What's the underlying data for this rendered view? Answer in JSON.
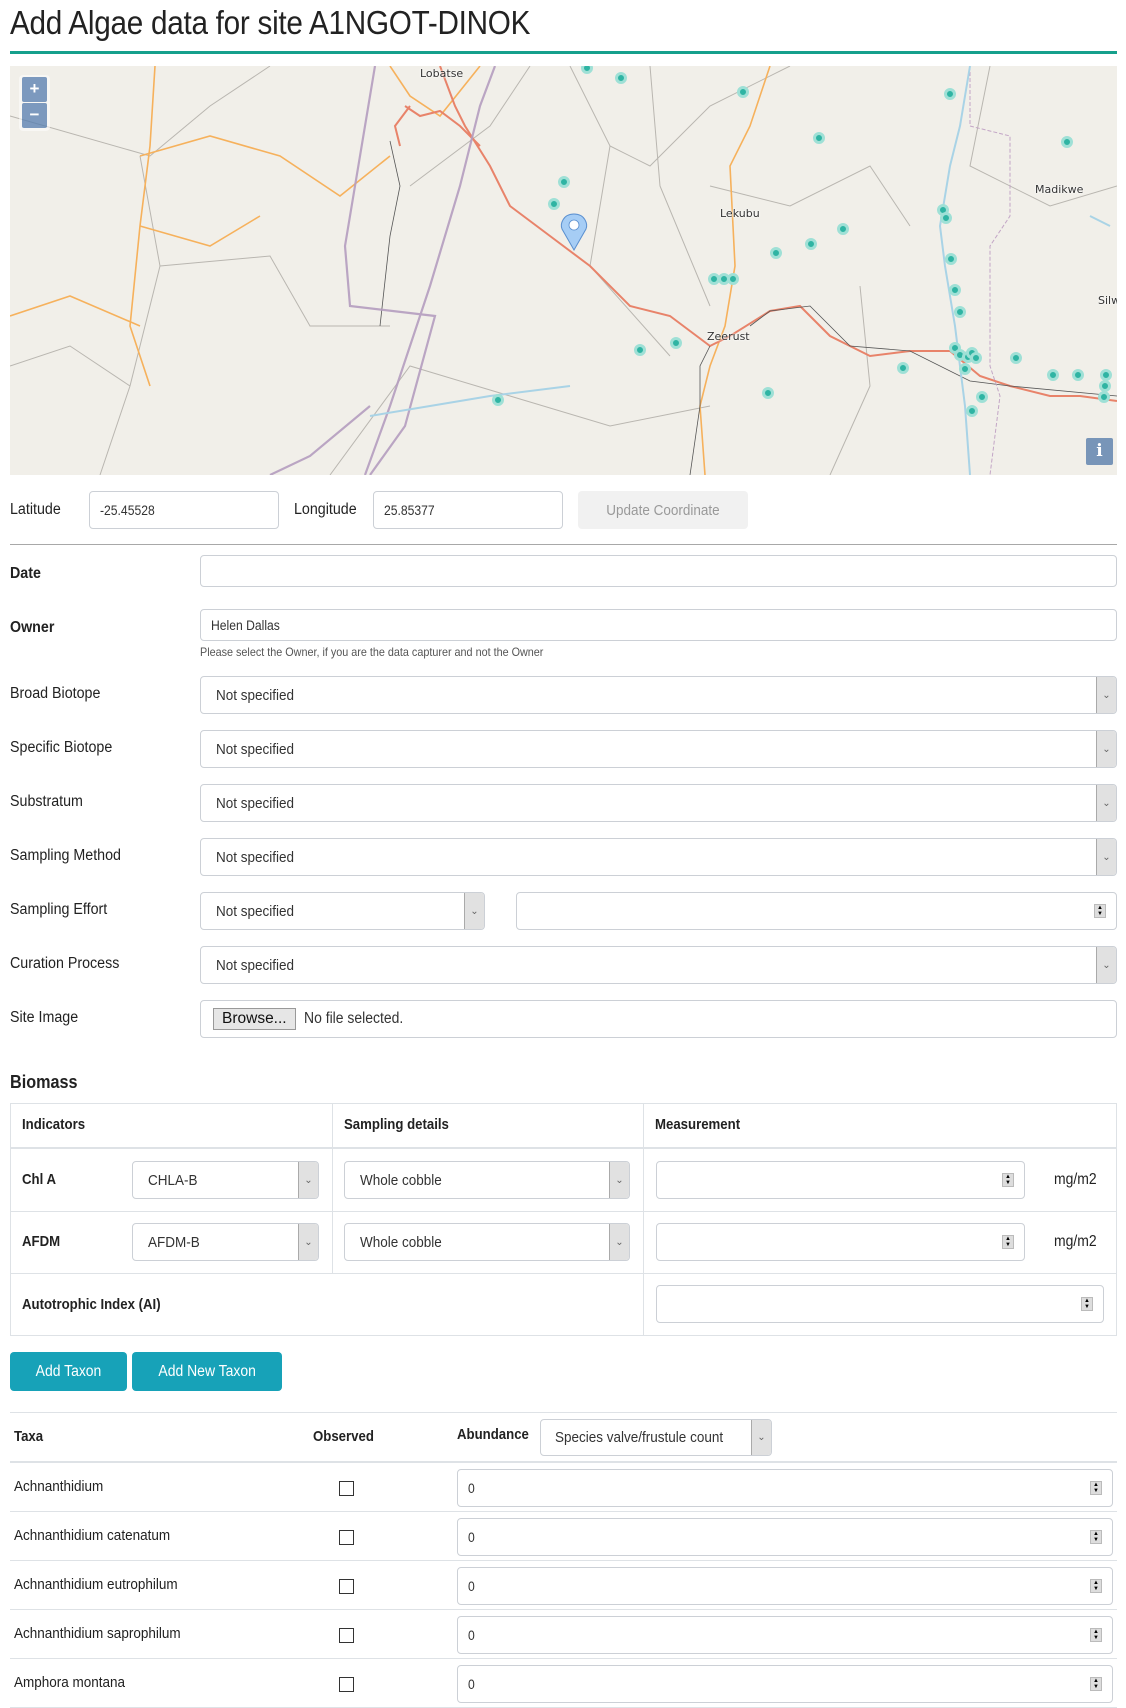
{
  "page": {
    "title": "Add Algae data for site A1NGOT-DINOK",
    "accent_color": "#16a08c",
    "button_color": "#17a2b8"
  },
  "map": {
    "zoom_in": "+",
    "zoom_out": "−",
    "info": "i",
    "place_labels": [
      "Lobatse",
      "Lekubu",
      "Zeerust",
      "Madikwe",
      "Silwe"
    ],
    "marker_icon": "map-pin-icon"
  },
  "coordinates": {
    "latitude_label": "Latitude",
    "latitude_value": "-25.45528",
    "longitude_label": "Longitude",
    "longitude_value": "25.85377",
    "update_button": "Update Coordinate"
  },
  "form": {
    "date_label": "Date",
    "date_value": "",
    "owner_label": "Owner",
    "owner_value": "Helen Dallas",
    "owner_help": "Please select the Owner, if you are the data capturer and not the Owner",
    "broad_biotope_label": "Broad Biotope",
    "broad_biotope_value": "Not specified",
    "specific_biotope_label": "Specific Biotope",
    "specific_biotope_value": "Not specified",
    "substratum_label": "Substratum",
    "substratum_value": "Not specified",
    "sampling_method_label": "Sampling Method",
    "sampling_method_value": "Not specified",
    "sampling_effort_label": "Sampling Effort",
    "sampling_effort_value": "Not specified",
    "sampling_effort_amount": "",
    "curation_process_label": "Curation Process",
    "curation_process_value": "Not specified",
    "site_image_label": "Site Image",
    "browse_button": "Browse...",
    "file_status": "No file selected."
  },
  "biomass": {
    "heading": "Biomass",
    "headers": [
      "Indicators",
      "Sampling details",
      "Measurement"
    ],
    "rows": [
      {
        "indicator": "Chl A",
        "type": "CHLA-B",
        "sampling": "Whole cobble",
        "measurement": "",
        "unit": "mg/m2"
      },
      {
        "indicator": "AFDM",
        "type": "AFDM-B",
        "sampling": "Whole cobble",
        "measurement": "",
        "unit": "mg/m2"
      }
    ],
    "ai_label": "Autotrophic Index (AI)",
    "ai_value": ""
  },
  "taxa": {
    "add_taxon_button": "Add Taxon",
    "add_new_taxon_button": "Add New Taxon",
    "headers": {
      "taxa": "Taxa",
      "observed": "Observed",
      "abundance": "Abundance"
    },
    "abundance_type": "Species valve/frustule count",
    "rows": [
      {
        "name": "Achnanthidium",
        "observed": false,
        "abundance": "0"
      },
      {
        "name": "Achnanthidium catenatum",
        "observed": false,
        "abundance": "0"
      },
      {
        "name": "Achnanthidium eutrophilum",
        "observed": false,
        "abundance": "0"
      },
      {
        "name": "Achnanthidium saprophilum",
        "observed": false,
        "abundance": "0"
      },
      {
        "name": "Amphora montana",
        "observed": false,
        "abundance": "0"
      }
    ]
  }
}
